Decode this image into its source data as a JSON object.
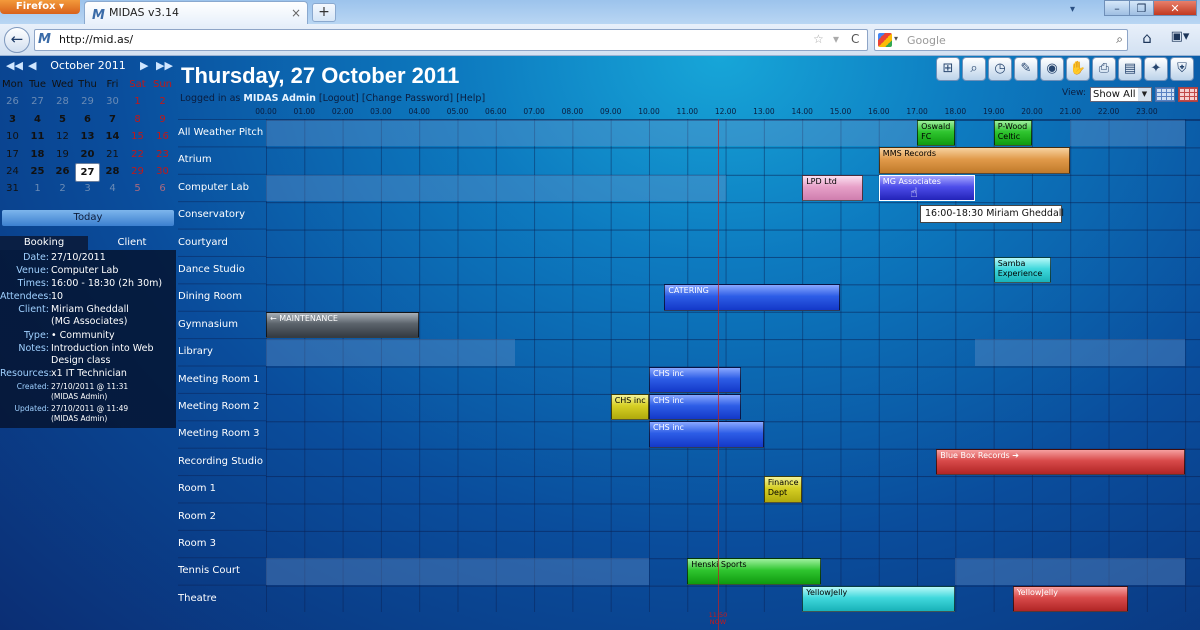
{
  "browser": {
    "app_button": "Firefox ▾",
    "tab_title": "MIDAS v3.14",
    "tab_logo": "M",
    "tab_close": "×",
    "new_tab": "+",
    "tab_list_arrow": "▾",
    "win_min": "–",
    "win_max": "❐",
    "win_close": "✕",
    "back": "←",
    "favicon": "M",
    "url": "http://mid.as/",
    "bookmark_star": "☆",
    "url_arrow": "▾",
    "reload": "C",
    "search_drop": "▾",
    "search_placeholder": "Google",
    "search_icon": "⌕",
    "home_icon": "⌂",
    "bookmarks_icon": "▣▾"
  },
  "calendar": {
    "prev_year": "◀◀",
    "prev": "◀",
    "month_label": "October 2011",
    "next": "▶",
    "next_year": "▶▶",
    "weekdays": [
      "Mon",
      "Tue",
      "Wed",
      "Thu",
      "Fri",
      "Sat",
      "Sun"
    ],
    "weeks": [
      [
        "26",
        "27",
        "28",
        "29",
        "30",
        "1",
        "2"
      ],
      [
        "3",
        "4",
        "5",
        "6",
        "7",
        "8",
        "9"
      ],
      [
        "10",
        "11",
        "12",
        "13",
        "14",
        "15",
        "16"
      ],
      [
        "17",
        "18",
        "19",
        "20",
        "21",
        "22",
        "23"
      ],
      [
        "24",
        "25",
        "26",
        "27",
        "28",
        "29",
        "30"
      ],
      [
        "31",
        "1",
        "2",
        "3",
        "4",
        "5",
        "6"
      ]
    ],
    "today_button": "Today"
  },
  "panel_tabs": {
    "booking": "Booking",
    "client": "Client"
  },
  "booking_info": {
    "date_label": "Date:",
    "date": "27/10/2011",
    "venue_label": "Venue:",
    "venue": "Computer Lab",
    "times_label": "Times:",
    "times": "16:00 - 18:30 (2h 30m)",
    "attendees_label": "Attendees:",
    "attendees": "10",
    "client_label": "Client:",
    "client_line1": "Miriam Gheddall",
    "client_line2": "(MG Associates)",
    "type_label": "Type:",
    "type": "• Community",
    "notes_label": "Notes:",
    "notes_line1": "Introduction into Web",
    "notes_line2": "Design class",
    "resources_label": "Resources:",
    "resources": "x1 IT Technician",
    "created_label": "Created:",
    "created_line1": "27/10/2011 @ 11:31",
    "created_line2": "(MIDAS Admin)",
    "updated_label": "Updated:",
    "updated_line1": "27/10/2011 @ 11:49",
    "updated_line2": "(MIDAS Admin)"
  },
  "header": {
    "date_title": "Thursday, 27 October 2011",
    "logged_in_prefix": "Logged in as",
    "user": "MIDAS Admin",
    "logout": "[Logout]",
    "change_password": "[Change Password]",
    "help": "[Help]",
    "view_label": "View:",
    "view_select": "Show All"
  },
  "toolbar_icons": [
    "add-booking-icon",
    "find-booking-icon",
    "clock-icon",
    "search-icon",
    "eye-icon",
    "hand-icon",
    "print-icon",
    "document-icon",
    "wrench-icon",
    "shield-icon"
  ],
  "toolbar_glyphs": [
    "⊞",
    "⌕",
    "◷",
    "✎",
    "◉",
    "✋",
    "⎙",
    "▤",
    "✦",
    "⛨"
  ],
  "hours": [
    "00.00",
    "01.00",
    "02.00",
    "03.00",
    "04.00",
    "05.00",
    "06.00",
    "07.00",
    "08.00",
    "09.00",
    "10.00",
    "11.00",
    "12.00",
    "13.00",
    "14.00",
    "15.00",
    "16.00",
    "17.00",
    "18.00",
    "19.00",
    "20.00",
    "21.00",
    "22.00",
    "23.00"
  ],
  "rooms": [
    "All Weather Pitch",
    "Atrium",
    "Computer Lab",
    "Conservatory",
    "Courtyard",
    "Dance Studio",
    "Dining Room",
    "Gymnasium",
    "Library",
    "Meeting Room 1",
    "Meeting Room 2",
    "Meeting Room 3",
    "Recording Studio",
    "Room 1",
    "Room 2",
    "Room 3",
    "Tennis Court",
    "Theatre"
  ],
  "bookings": [
    {
      "room": 0,
      "start": 17.0,
      "end": 18.0,
      "label1": "Oswald",
      "label2": "FC",
      "color": "green"
    },
    {
      "room": 0,
      "start": 19.0,
      "end": 20.0,
      "label1": "P-Wood",
      "label2": "Celtic",
      "color": "green"
    },
    {
      "room": 1,
      "start": 16.0,
      "end": 21.0,
      "label1": "MMS Records",
      "label2": "",
      "color": "orange"
    },
    {
      "room": 2,
      "start": 14.0,
      "end": 15.6,
      "label1": "LPD Ltd",
      "label2": "",
      "color": "pink"
    },
    {
      "room": 2,
      "start": 16.0,
      "end": 18.5,
      "label1": "MG Associates",
      "label2": "",
      "color": "purple"
    },
    {
      "room": 5,
      "start": 19.0,
      "end": 20.5,
      "label1": "Samba",
      "label2": "Experience",
      "color": "cyan"
    },
    {
      "room": 6,
      "start": 10.4,
      "end": 15.0,
      "label1": "CATERING",
      "label2": "",
      "color": "blue"
    },
    {
      "room": 7,
      "start": 0.0,
      "end": 4.0,
      "label1": "← MAINTENANCE",
      "label2": "",
      "color": "grey"
    },
    {
      "room": 9,
      "start": 10.0,
      "end": 12.4,
      "label1": "CHS inc",
      "label2": "",
      "color": "blue"
    },
    {
      "room": 10,
      "start": 9.0,
      "end": 10.0,
      "label1": "CHS inc",
      "label2": "",
      "color": "yellow"
    },
    {
      "room": 10,
      "start": 10.0,
      "end": 12.4,
      "label1": "CHS inc",
      "label2": "",
      "color": "blue"
    },
    {
      "room": 11,
      "start": 10.0,
      "end": 13.0,
      "label1": "CHS inc",
      "label2": "",
      "color": "blue"
    },
    {
      "room": 12,
      "start": 17.5,
      "end": 24.0,
      "label1": "Blue Box Records ➔",
      "label2": "",
      "color": "red"
    },
    {
      "room": 13,
      "start": 13.0,
      "end": 14.0,
      "label1": "Finance",
      "label2": "Dept",
      "color": "yellow"
    },
    {
      "room": 16,
      "start": 11.0,
      "end": 14.5,
      "label1": "Henski Sports",
      "label2": "",
      "color": "green"
    },
    {
      "room": 17,
      "start": 14.0,
      "end": 18.0,
      "label1": "YellowJelly",
      "label2": "",
      "color": "cyan"
    },
    {
      "room": 17,
      "start": 19.5,
      "end": 22.5,
      "label1": "YellowJelly",
      "label2": "",
      "color": "red"
    }
  ],
  "unavailable": [
    {
      "room": 0,
      "start": 0.0,
      "end": 17.0
    },
    {
      "room": 0,
      "start": 21.0,
      "end": 24.0
    },
    {
      "room": 2,
      "start": 0.0,
      "end": 12.0
    },
    {
      "room": 8,
      "start": 0.0,
      "end": 6.5
    },
    {
      "room": 8,
      "start": 18.5,
      "end": 24.0
    },
    {
      "room": 16,
      "start": 0.0,
      "end": 10.0
    },
    {
      "room": 16,
      "start": 18.0,
      "end": 24.0
    }
  ],
  "now_marker": {
    "hour": 11.8,
    "time": "11:50",
    "label": "NOW"
  },
  "tooltip": "16:00-18:30 Miriam Gheddall"
}
